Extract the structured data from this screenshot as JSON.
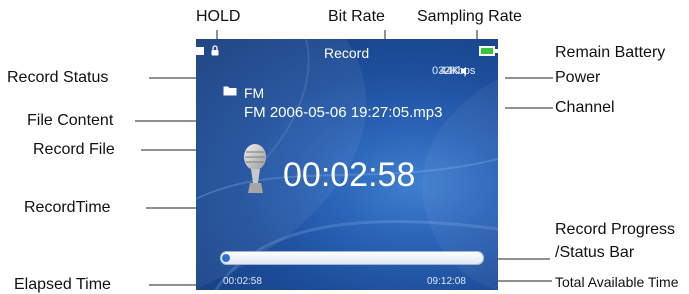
{
  "callouts": {
    "hold": "HOLD",
    "bit_rate": "Bit Rate",
    "sampling_rate": "Sampling Rate",
    "remain_battery_power_line1": "Remain Battery",
    "remain_battery_power_line2": "Power",
    "record_status": "Record Status",
    "channel": "Channel",
    "file_content": "File Content",
    "record_file": "Record File",
    "record_time": "RecordTime",
    "record_progress_line1": "Record Progress",
    "record_progress_line2": "/Status Bar",
    "elapsed_time": "Elapsed Time",
    "total_available_time": "Total Available Time"
  },
  "screen": {
    "title": "Record",
    "bit_rate": "032Kbps",
    "sampling_rate": "44K",
    "file_content": "FM",
    "record_file": "FM 2006-05-06 19:27:05.mp3",
    "record_time": "00:02:58",
    "elapsed_time": "00:02:58",
    "total_available_time": "09:12:08",
    "progress": 0.02
  },
  "icons": [
    "record-status-icon",
    "lock-icon",
    "battery-icon",
    "channel-icon",
    "folder-icon",
    "microphone-icon"
  ],
  "colors": {
    "screen_bg": "#1d4f9c",
    "screen_text": "#ffffff",
    "progress_fill": "#2f6fd3",
    "callout_text": "#111111"
  }
}
